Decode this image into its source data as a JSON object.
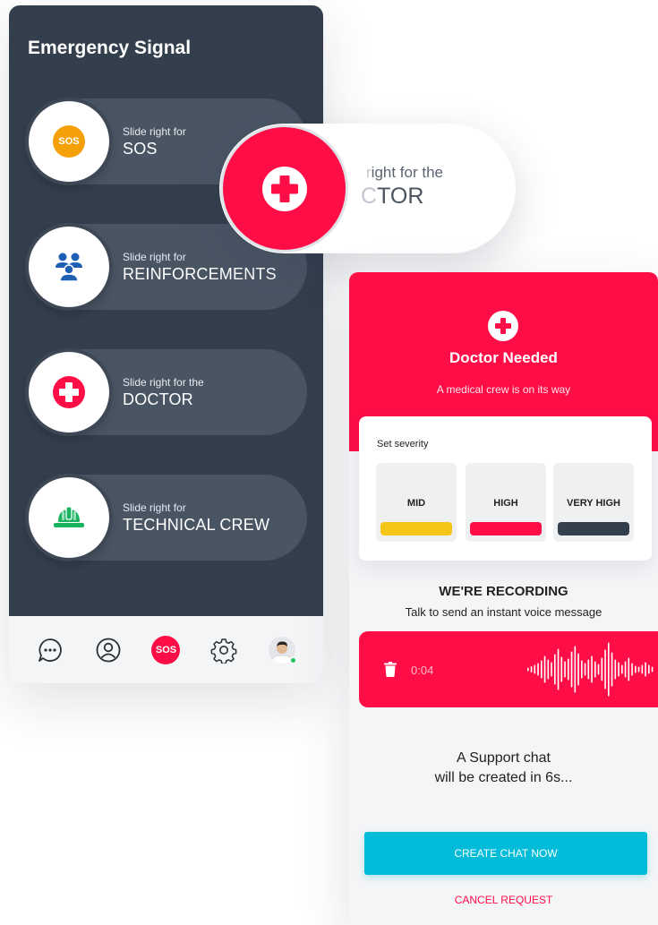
{
  "colors": {
    "dark_panel": "#333f4d",
    "slider_track": "#4a5564",
    "accent_red": "#ff0d47",
    "sos_orange": "#f5a009",
    "reinforcement_blue": "#1d5fb3",
    "technical_green": "#19b35f",
    "mid_yellow": "#f5c518",
    "very_high_dark": "#333f4d",
    "cta_teal": "#00bcd8"
  },
  "left_panel": {
    "title": "Emergency Signal",
    "sliders": [
      {
        "prefix": "Slide right for",
        "label": "SOS",
        "icon": "sos-icon",
        "icon_text": "SOS"
      },
      {
        "prefix": "Slide right for",
        "label": "REINFORCEMENTS",
        "icon": "group-icon"
      },
      {
        "prefix": "Slide right for the",
        "label": "DOCTOR",
        "icon": "medical-cross-icon"
      },
      {
        "prefix": "Slide right for",
        "label": "TECHNICAL CREW",
        "icon": "hard-hat-icon"
      }
    ],
    "nav": {
      "items": [
        "chat-icon",
        "profile-icon",
        "sos-button",
        "settings-icon",
        "avatar"
      ],
      "sos_label": "SOS"
    }
  },
  "zoom_pill": {
    "prefix_faded": "r",
    "prefix": "ight for the",
    "main_faded": "C",
    "main": "TOR"
  },
  "right_panel": {
    "header": {
      "title": "Doctor Needed",
      "subtitle": "A medical crew is on its way"
    },
    "severity": {
      "label": "Set severity",
      "options": [
        {
          "label": "MID",
          "color": "#f5c518"
        },
        {
          "label": "HIGH",
          "color": "#ff0d47"
        },
        {
          "label": "VERY HIGH",
          "color": "#333f4d"
        }
      ]
    },
    "recording": {
      "title": "WE'RE RECORDING",
      "subtitle": "Talk to send an instant voice message",
      "time": "0:04"
    },
    "support": {
      "line1": "A Support chat",
      "line2": "will be created in 6s..."
    },
    "create_button": "CREATE CHAT NOW",
    "cancel_link": "CANCEL REQUEST"
  }
}
